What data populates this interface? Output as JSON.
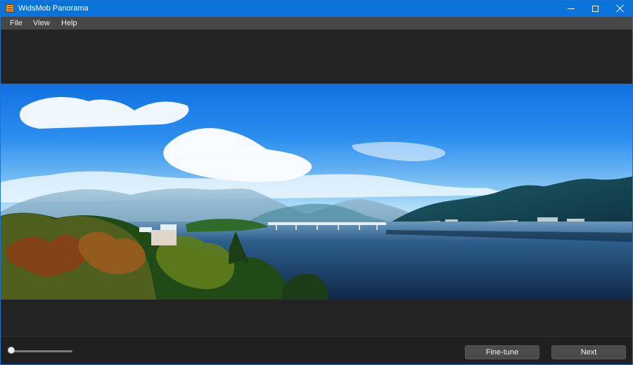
{
  "window": {
    "title": "WidsMob Panorama",
    "accent_color": "#0a74da",
    "icons": {
      "app": "app-icon",
      "minimize": "minimize-icon",
      "maximize": "maximize-icon",
      "close": "close-icon"
    }
  },
  "menu": {
    "items": [
      "File",
      "View",
      "Help"
    ]
  },
  "bottom_bar": {
    "zoom_value": 0,
    "fine_tune_label": "Fine-tune",
    "next_label": "Next"
  }
}
